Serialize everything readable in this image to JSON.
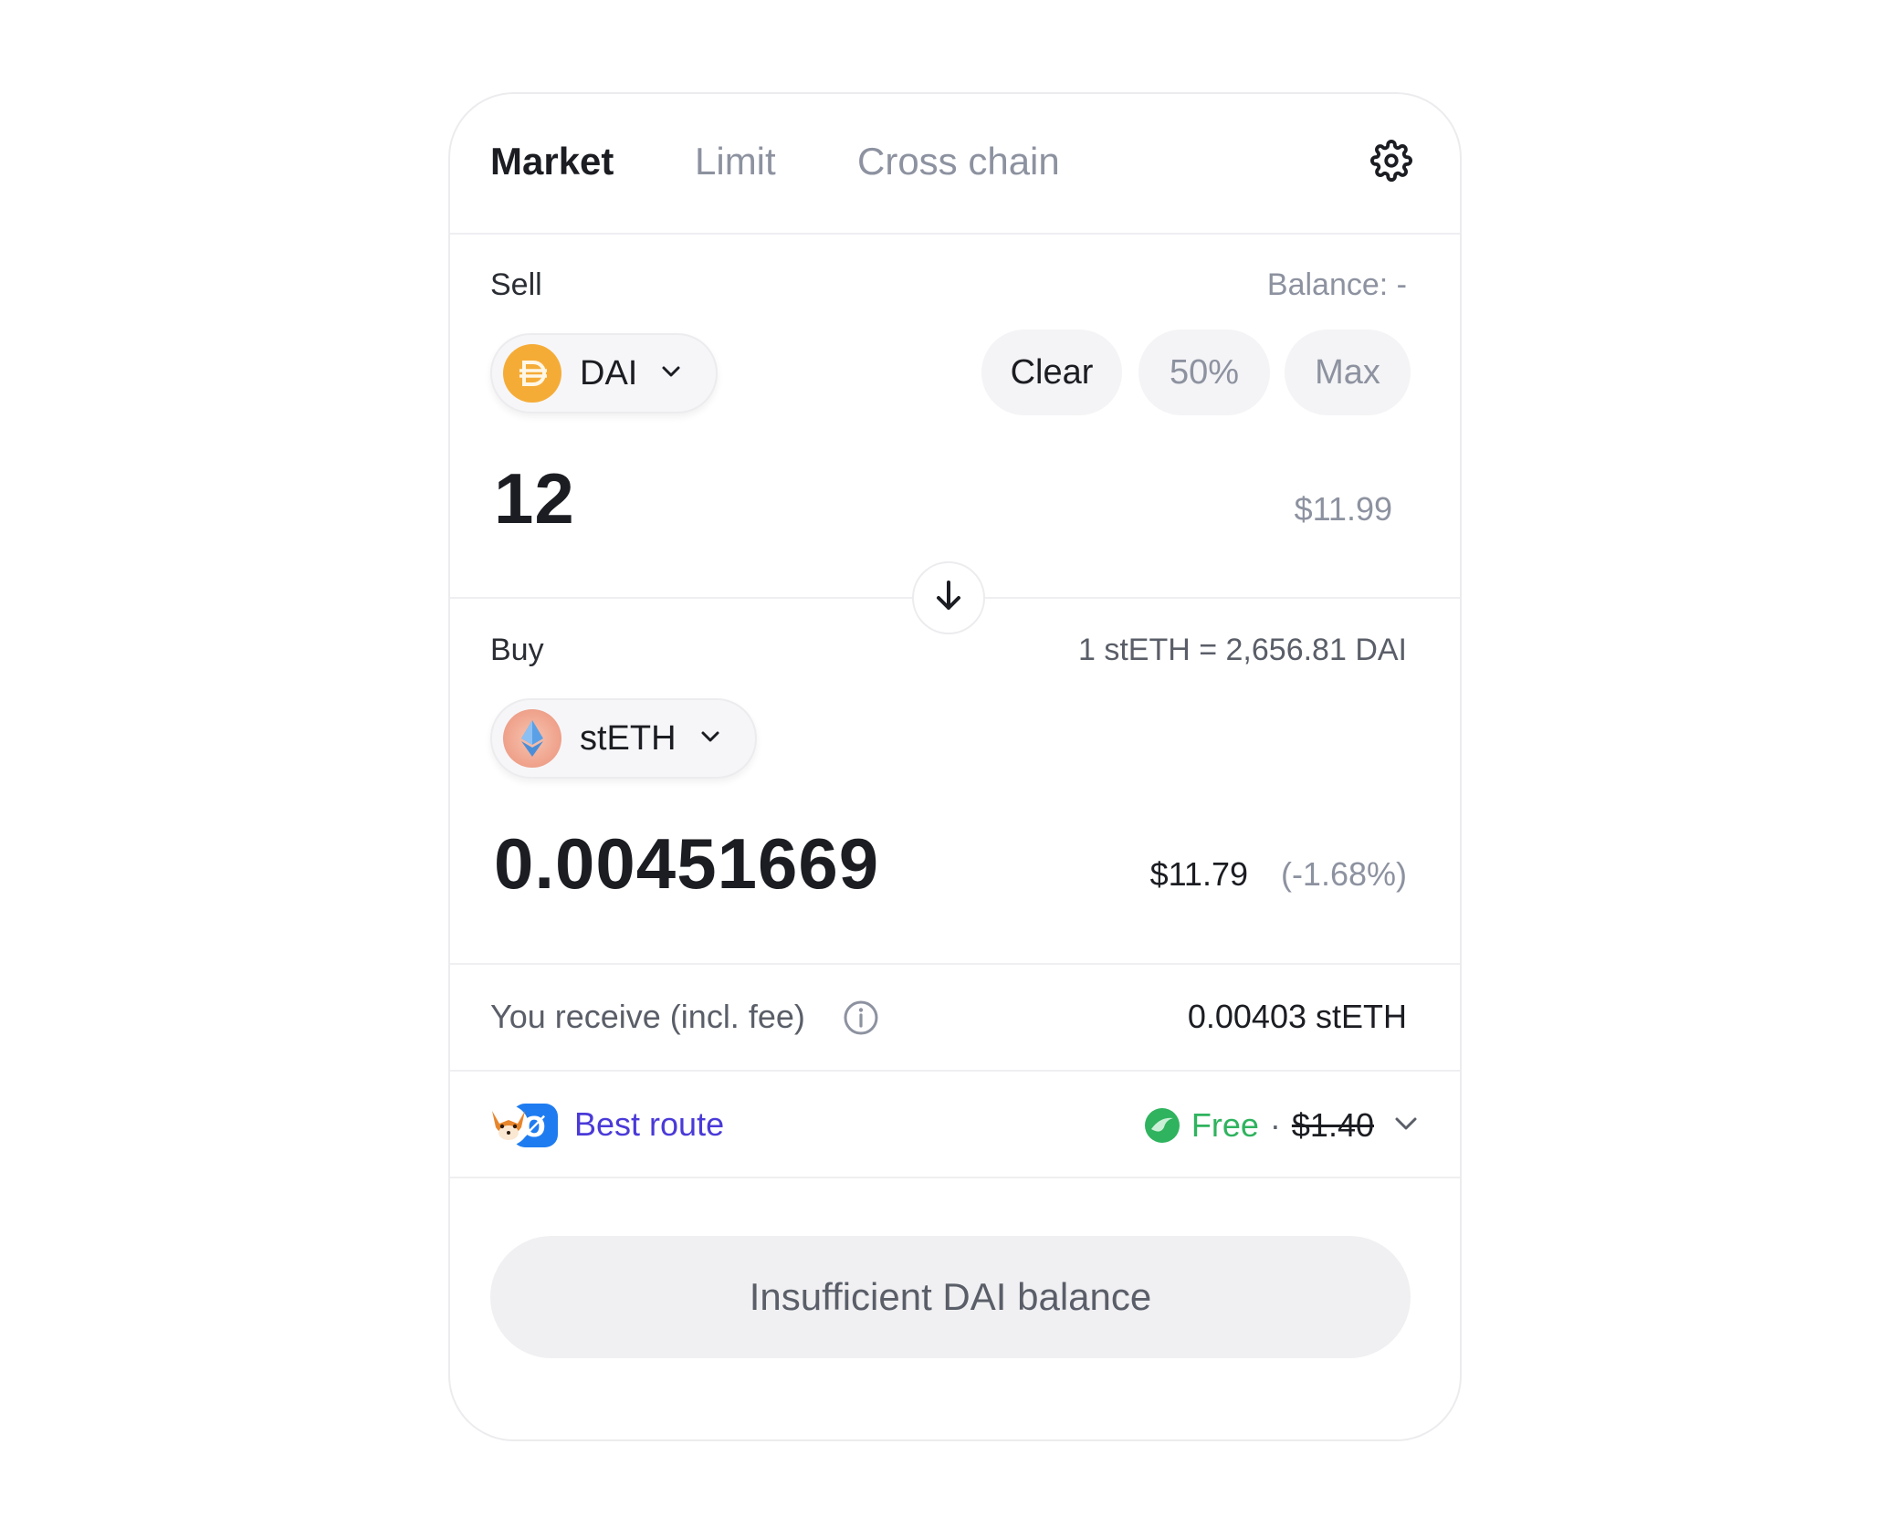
{
  "tabs": {
    "market": "Market",
    "limit": "Limit",
    "cross_chain": "Cross chain"
  },
  "settings_icon": "gear-icon",
  "sell": {
    "label": "Sell",
    "balance": "Balance: -",
    "token": "DAI",
    "token_icon": "dai-token-icon",
    "clear_label": "Clear",
    "half_label": "50%",
    "max_label": "Max",
    "amount": "12",
    "usd_value": "$11.99"
  },
  "swap_icon": "arrow-down-icon",
  "buy": {
    "label": "Buy",
    "rate": "1 stETH = 2,656.81 DAI",
    "token": "stETH",
    "token_icon": "steth-token-icon",
    "amount": "0.00451669",
    "usd_value": "$11.79",
    "price_impact": "(-1.68%)"
  },
  "receive": {
    "label": "You receive (incl. fee)",
    "value": "0.00403 stETH"
  },
  "route": {
    "label": "Best route",
    "fee_label": "Free",
    "separator": "·",
    "original_fee": "$1.40"
  },
  "cta_label": "Insufficient DAI balance",
  "colors": {
    "accent_purple": "#4a3ad8",
    "free_green": "#2fb35e",
    "dai_orange": "#f5ac37",
    "muted_gray": "#8d92a0"
  }
}
